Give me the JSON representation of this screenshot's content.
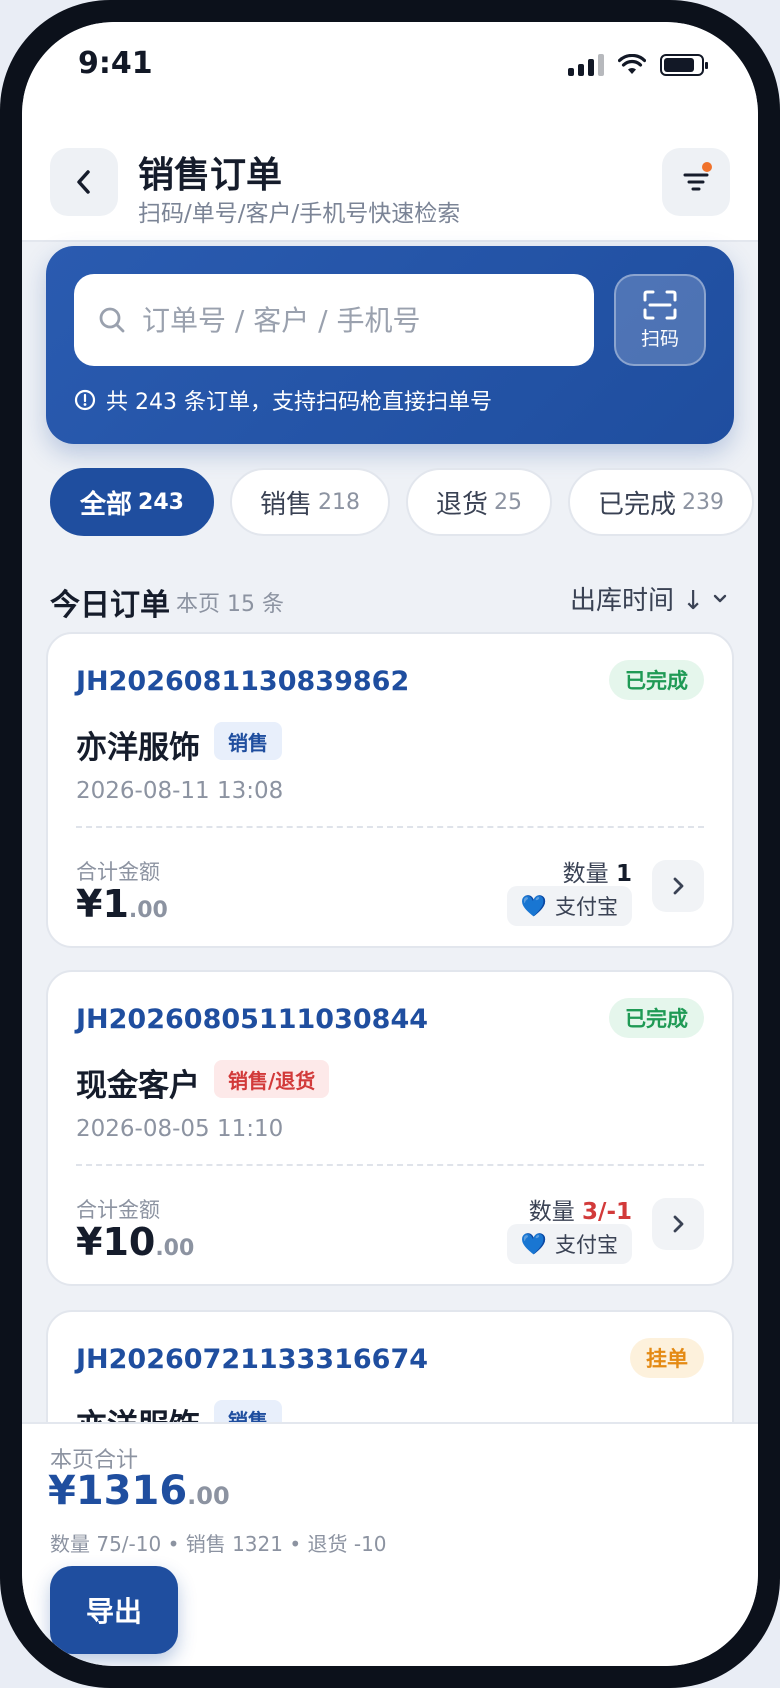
{
  "status_bar": {
    "time": "9:41"
  },
  "header": {
    "title": "销售订单",
    "subtitle": "扫码/单号/客户/手机号快速检索"
  },
  "search": {
    "placeholder": "订单号 / 客户 / 手机号",
    "scan_label": "扫码",
    "hint": "共 243 条订单，支持扫码枪直接扫单号"
  },
  "tabs": [
    {
      "label": "全部",
      "count": "243",
      "active": true
    },
    {
      "label": "销售",
      "count": "218",
      "active": false
    },
    {
      "label": "退货",
      "count": "25",
      "active": false
    },
    {
      "label": "已完成",
      "count": "239",
      "active": false
    }
  ],
  "section": {
    "title": "今日订单",
    "count": "本页 15 条",
    "sort_label": "出库时间 ↓"
  },
  "orders": [
    {
      "order_no": "JH2026081130839862",
      "status": "已完成",
      "customer": "亦洋服饰",
      "type": "销售",
      "date": "2026-08-11 13:08",
      "amount_label": "合计金额",
      "amount_int": "¥1",
      "amount_dec": ".00",
      "qty_label": "数量",
      "qty": "1",
      "payment": "支付宝"
    },
    {
      "order_no": "JH20260805111030844",
      "status": "已完成",
      "customer": "现金客户",
      "type": "销售/退货",
      "date": "2026-08-05 11:10",
      "amount_label": "合计金额",
      "amount_int": "¥10",
      "amount_dec": ".00",
      "qty_label": "数量",
      "qty": "3/-1",
      "payment": "支付宝"
    },
    {
      "order_no": "JH20260721133316674",
      "status": "挂单",
      "customer": "亦洋服饰",
      "type": "销售"
    }
  ],
  "summary": {
    "label": "本页合计",
    "amount_int": "¥1316",
    "amount_dec": ".00",
    "detail": "数量 75/-10 • 销售 1321 • 退货 -10",
    "export_label": "导出"
  },
  "colors": {
    "primary": "#1f4e9f",
    "success": "#1f9a55",
    "warning": "#e48a14",
    "danger": "#d23a3a"
  }
}
